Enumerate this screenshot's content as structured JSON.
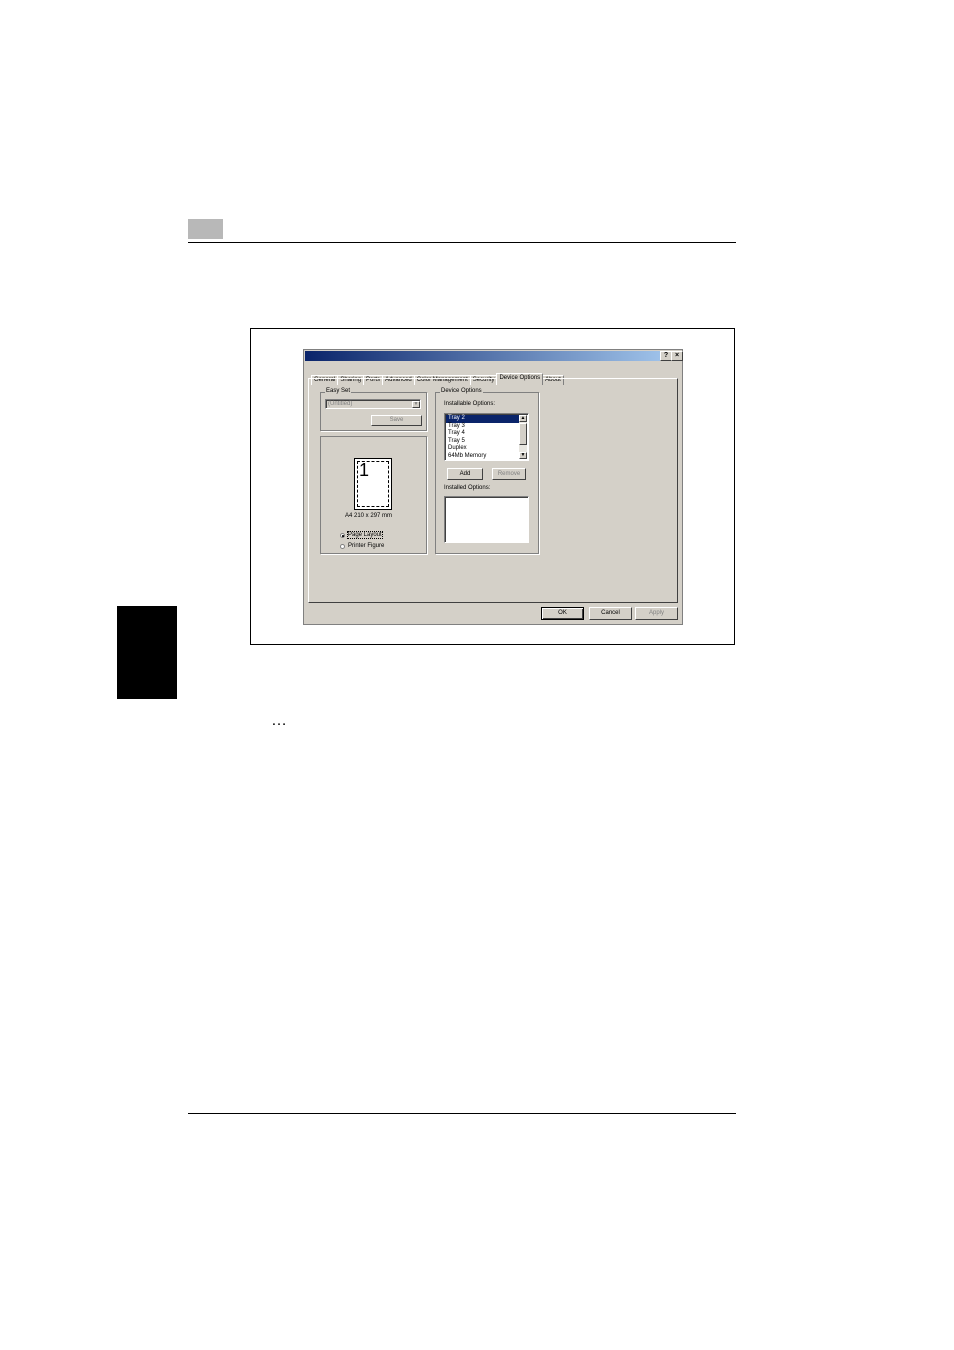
{
  "page": {
    "dots": "…"
  },
  "dialog": {
    "title_buttons": {
      "help": "?",
      "close": "×"
    },
    "tabs": [
      {
        "label": "General"
      },
      {
        "label": "Sharing"
      },
      {
        "label": "Ports"
      },
      {
        "label": "Advanced"
      },
      {
        "label": "Color Management"
      },
      {
        "label": "Security"
      },
      {
        "label": "Device Options"
      },
      {
        "label": "About"
      }
    ],
    "easy_set": {
      "label": "Easy Set",
      "value": "(Untitled)",
      "save_label": "Save"
    },
    "preview": {
      "page_number": "1",
      "paper_size": "A4 210 x 297 mm",
      "radio_page_layout": "Page Layout",
      "radio_printer_figure": "Printer Figure"
    },
    "device_options": {
      "group_label": "Device Options",
      "installable_label": "Installable Options:",
      "installable_items": [
        "Tray 2",
        "Tray 3",
        "Tray 4",
        "Tray 5",
        "Duplex",
        "64Mb Memory"
      ],
      "add_label": "Add",
      "remove_label": "Remove",
      "installed_label": "Installed Options:"
    },
    "footer": {
      "ok": "OK",
      "cancel": "Cancel",
      "apply": "Apply"
    }
  }
}
